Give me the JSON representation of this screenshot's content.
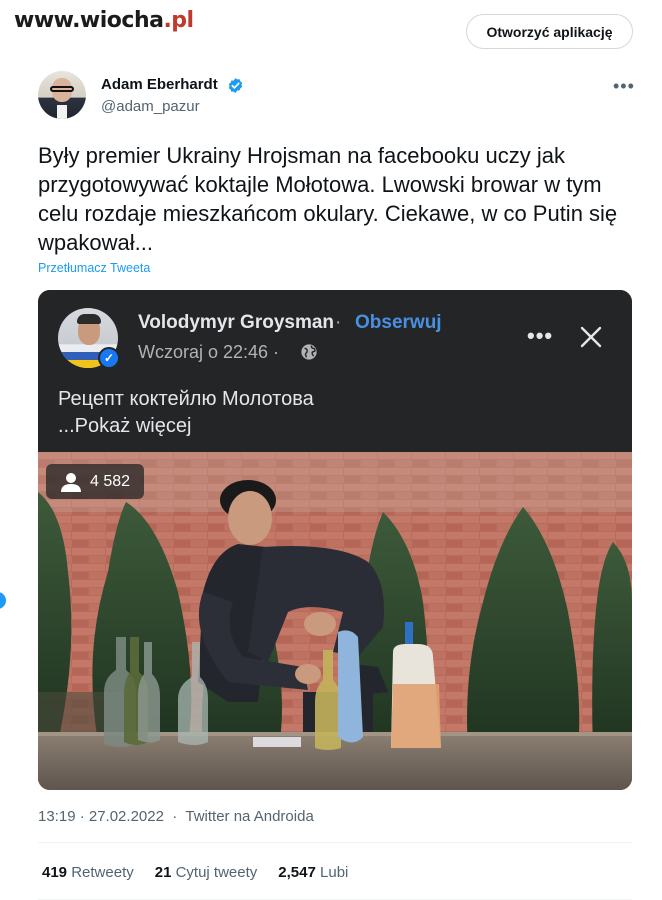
{
  "watermark": {
    "text_a": "www.wiocha",
    "text_b": ".pl"
  },
  "header": {
    "open_app_label": "Otworzyć aplikację"
  },
  "author": {
    "name": "Adam Eberhardt",
    "handle": "@adam_pazur"
  },
  "tweet": {
    "text": "Były premier Ukrainy Hrojsman na facebooku uczy jak przygotowywać koktajle Mołotowa. Lwowski browar w tym celu rozdaje mieszkańcom okulary. Ciekawe, w co Putin się wpakował...",
    "translate_label": "Przetłumacz Tweeta",
    "timestamp": "13:19 · 27.02.2022",
    "source": "Twitter na Androida"
  },
  "fb_post": {
    "author": "Volodymyr Groysman",
    "separator": "·",
    "follow_label": "Obserwuj",
    "date": "Wczoraj o 22:46 ·",
    "text_line1": "Рецепт коктейлю Молотова",
    "text_line2": "...Pokaż więcej",
    "viewers": "4 582"
  },
  "stats": {
    "retweets_count": "419",
    "retweets_label": "Retweety",
    "quotes_count": "21",
    "quotes_label": "Cytuj tweety",
    "likes_count": "2,547",
    "likes_label": "Lubi"
  },
  "icons": [
    "verified-badge-icon",
    "more-icon",
    "globe-icon",
    "close-icon",
    "person-icon"
  ],
  "colors": {
    "twitter_blue": "#1d9bf0",
    "fb_dark": "#242526",
    "fb_link": "#4a90e2"
  }
}
